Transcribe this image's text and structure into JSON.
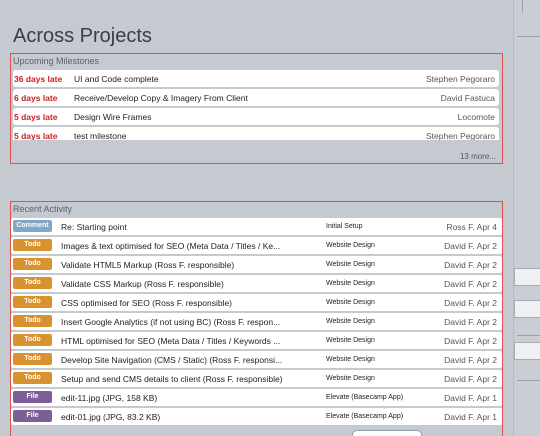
{
  "page": {
    "title": "Across Projects"
  },
  "milestones": {
    "label": "Upcoming Milestones",
    "items": [
      {
        "late": "36 days late",
        "name": "UI and Code complete",
        "person": "Stephen Pegoraro"
      },
      {
        "late": "6 days late",
        "name": "Receive/Develop Copy & Imagery From Client",
        "person": "David Fastuca"
      },
      {
        "late": "5 days late",
        "name": "Design Wire Frames",
        "person": "Locomote"
      },
      {
        "late": "5 days late",
        "name": "test milestone",
        "person": "Stephen Pegoraro"
      }
    ],
    "more": "13 more..."
  },
  "activity": {
    "label": "Recent Activity",
    "items": [
      {
        "type": "Comment",
        "kind": "comment",
        "text": "Re: Starting point",
        "project": "Initial Setup",
        "author": "Ross F. Apr 4"
      },
      {
        "type": "Todo",
        "kind": "todo",
        "text": "Images & text optimised for SEO (Meta Data / Titles / Ke...",
        "project": "Website Design",
        "author": "David F. Apr 2"
      },
      {
        "type": "Todo",
        "kind": "todo",
        "text": "Validate HTML5 Markup (Ross F. responsible)",
        "project": "Website Design",
        "author": "David F. Apr 2"
      },
      {
        "type": "Todo",
        "kind": "todo",
        "text": "Validate CSS Markup (Ross F. responsible)",
        "project": "Website Design",
        "author": "David F. Apr 2"
      },
      {
        "type": "Todo",
        "kind": "todo",
        "text": "CSS optimised for SEO (Ross F. responsible)",
        "project": "Website Design",
        "author": "David F. Apr 2"
      },
      {
        "type": "Todo",
        "kind": "todo",
        "text": "Insert Google Analytics (if not using BC) (Ross F. respon...",
        "project": "Website Design",
        "author": "David F. Apr 2"
      },
      {
        "type": "Todo",
        "kind": "todo",
        "text": "HTML optimised for SEO (Meta Data / Titles / Keywords ...",
        "project": "Website Design",
        "author": "David F. Apr 2"
      },
      {
        "type": "Todo",
        "kind": "todo",
        "text": "Develop Site Navigation (CMS / Static) (Ross F. responsi...",
        "project": "Website Design",
        "author": "David F. Apr 2"
      },
      {
        "type": "Todo",
        "kind": "todo",
        "text": "Setup and send CMS details to client (Ross F. responsible)",
        "project": "Website Design",
        "author": "David F. Apr 2"
      },
      {
        "type": "File",
        "kind": "file",
        "text": "edit-11.jpg (JPG, 158 KB)",
        "project": "Elevate (Basecamp App)",
        "author": "David F. Apr 1"
      },
      {
        "type": "File",
        "kind": "file",
        "text": "edit-01.jpg (JPG, 83.2 KB)",
        "project": "Elevate (Basecamp App)",
        "author": "David F. Apr 1"
      }
    ]
  }
}
